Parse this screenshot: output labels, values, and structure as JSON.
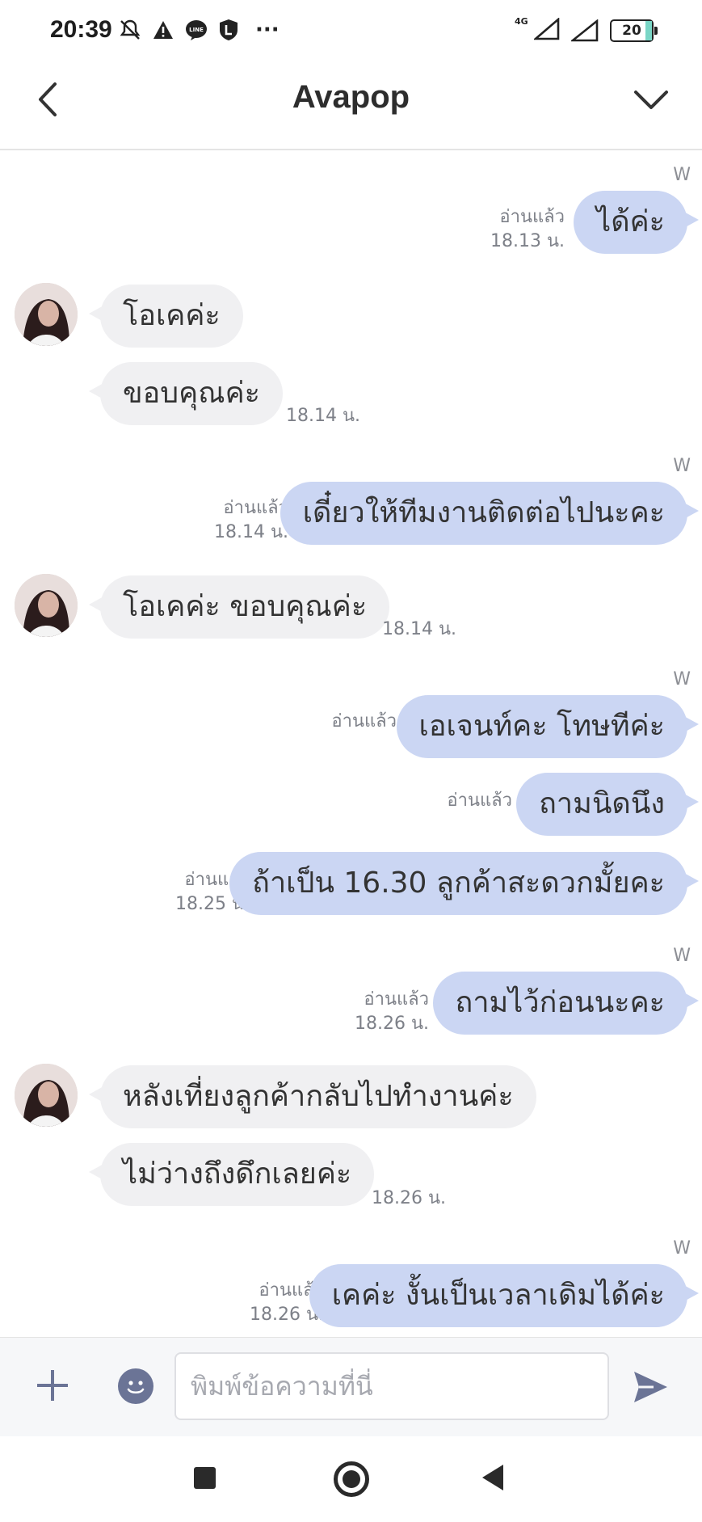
{
  "status_bar": {
    "time": "20:39",
    "network_label": "4G",
    "battery_level": "20",
    "overflow": "···"
  },
  "header": {
    "title": "Avapop"
  },
  "messages": [
    {
      "side": "out",
      "text": "ได้ค่ะ",
      "read": "อ่านแล้ว",
      "time": "18.13 น.",
      "w": "W"
    },
    {
      "side": "in",
      "text": "โอเคค่ะ"
    },
    {
      "side": "in",
      "text": "ขอบคุณค่ะ",
      "time": "18.14 น."
    },
    {
      "side": "out",
      "text": "เดี๋ยวให้ทีมงานติดต่อไปนะคะ",
      "read": "อ่านแล้ว",
      "time": "18.14 น.",
      "w": "W"
    },
    {
      "side": "in",
      "text": "โอเคค่ะ ขอบคุณค่ะ",
      "time": "18.14 น."
    },
    {
      "side": "out",
      "text": "เอเจนท์คะ โทษทีค่ะ",
      "read": "อ่านแล้ว",
      "w": "W"
    },
    {
      "side": "out",
      "text": "ถามนิดนึง",
      "read": "อ่านแล้ว"
    },
    {
      "side": "out",
      "text": "ถ้าเป็น 16.30 ลูกค้าสะดวกมั้ยคะ",
      "read": "อ่านแล้ว",
      "time": "18.25 น."
    },
    {
      "side": "out",
      "text": "ถามไว้ก่อนนะคะ",
      "read": "อ่านแล้ว",
      "time": "18.26 น.",
      "w": "W"
    },
    {
      "side": "in",
      "text": "หลังเที่ยงลูกค้ากลับไปทำงานค่ะ"
    },
    {
      "side": "in",
      "text": "ไม่ว่างถึงดึกเลยค่ะ",
      "time": "18.26 น."
    },
    {
      "side": "out",
      "text": "เคค่ะ งั้นเป็นเวลาเดิมได้ค่ะ",
      "read": "อ่านแล้ว",
      "time": "18.26 น.",
      "w": "W"
    }
  ],
  "input": {
    "placeholder": "พิมพ์ข้อความที่นี่"
  },
  "colors": {
    "outgoing_bubble": "#cbd6f3",
    "incoming_bubble": "#f0f0f2",
    "accent": "#6b7496"
  }
}
